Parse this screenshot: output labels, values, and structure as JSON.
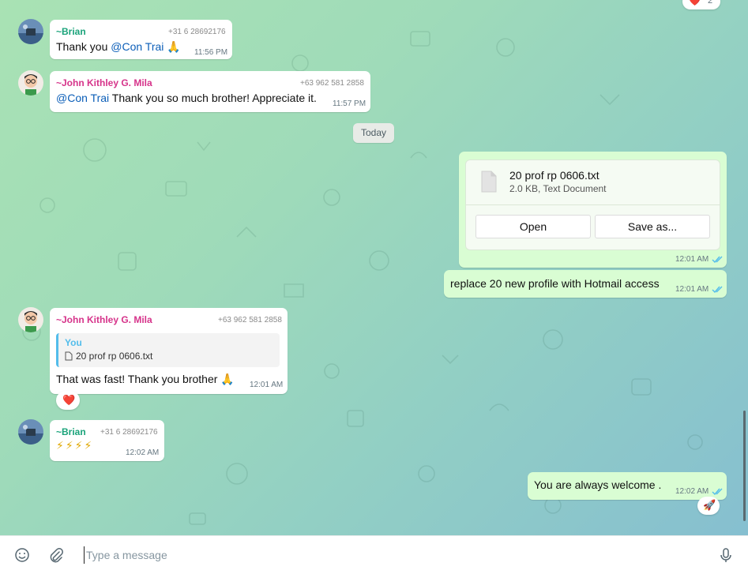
{
  "colors": {
    "brian_name": "#1aa37a",
    "john_name": "#d6338a",
    "mention": "#0b5eb8",
    "outgoing_bubble": "#d9fdd3",
    "ticks": "#53bdeb"
  },
  "top_reaction": {
    "emoji": "❤️",
    "count": "2"
  },
  "messages": [
    {
      "sender": "~Brian",
      "phone": "+31 6 28692176",
      "mention": "@Con Trai",
      "text_before": "Thank you ",
      "emoji": "🙏",
      "time": "11:56 PM"
    },
    {
      "sender": "~John Kithley G. Mila",
      "phone": "+63 962 581 2858",
      "mention": "@Con Trai",
      "text_after": " Thank you so much brother! Appreciate it.",
      "time": "11:57 PM"
    }
  ],
  "date_separator": "Today",
  "file_message": {
    "file_name": "20 prof rp 0606.txt",
    "file_meta": "2.0 KB, Text Document",
    "open_label": "Open",
    "save_label": "Save as...",
    "time": "12:01 AM",
    "file_icon": "document-icon"
  },
  "outgoing_text_1": {
    "text": "replace 20 new profile with Hotmail access",
    "time": "12:01 AM"
  },
  "reply_message": {
    "sender": "~John Kithley G. Mila",
    "phone": "+63 962 581 2858",
    "quote_author": "You",
    "quote_text": "20 prof rp 0606.txt",
    "text": "That was fast! Thank you brother 🙏",
    "time": "12:01 AM",
    "reaction": "❤️"
  },
  "bolt_message": {
    "sender": "~Brian",
    "phone": "+31 6 28692176",
    "text": "⚡⚡⚡⚡",
    "time": "12:02 AM"
  },
  "outgoing_text_2": {
    "text": "You are always welcome .",
    "time": "12:02 AM",
    "reaction": "🚀"
  },
  "composer": {
    "placeholder": "Type a message",
    "emoji_icon": "emoji-icon",
    "attach_icon": "paperclip-icon",
    "mic_icon": "microphone-icon"
  }
}
